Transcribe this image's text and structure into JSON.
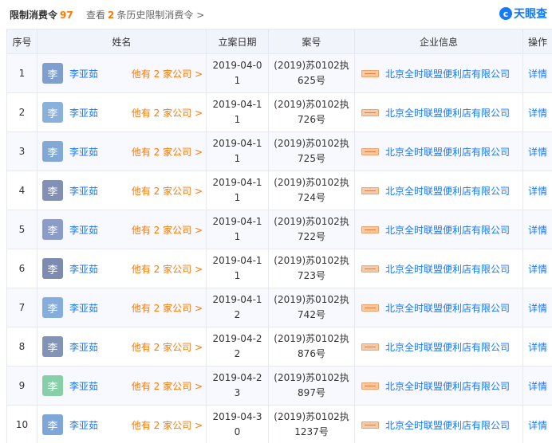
{
  "header": {
    "title": "限制消费令",
    "count": "97",
    "history_prefix": "查看",
    "history_count": "2",
    "history_suffix": "条历史限制消费令 >",
    "logo_mark": "c",
    "logo_text": "天眼查"
  },
  "columns": {
    "index": "序号",
    "name": "姓名",
    "date": "立案日期",
    "case": "案号",
    "company": "企业信息",
    "action": "操作"
  },
  "rows": [
    {
      "index": "1",
      "avatar": "李",
      "avatar_color": "#7f9fcf",
      "name": "李亚茹",
      "others": "他有 2 家公司 >",
      "date": "2019-04-01",
      "case": "(2019)苏0102执625号",
      "company": "北京全时联盟便利店有限公司",
      "action": "详情"
    },
    {
      "index": "2",
      "avatar": "李",
      "avatar_color": "#8ab0dc",
      "name": "李亚茹",
      "others": "他有 2 家公司 >",
      "date": "2019-04-11",
      "case": "(2019)苏0102执726号",
      "company": "北京全时联盟便利店有限公司",
      "action": "详情"
    },
    {
      "index": "3",
      "avatar": "李",
      "avatar_color": "#82a8d6",
      "name": "李亚茹",
      "others": "他有 2 家公司 >",
      "date": "2019-04-11",
      "case": "(2019)苏0102执725号",
      "company": "北京全时联盟便利店有限公司",
      "action": "详情"
    },
    {
      "index": "4",
      "avatar": "李",
      "avatar_color": "#8290b5",
      "name": "李亚茹",
      "others": "他有 2 家公司 >",
      "date": "2019-04-11",
      "case": "(2019)苏0102执724号",
      "company": "北京全时联盟便利店有限公司",
      "action": "详情"
    },
    {
      "index": "5",
      "avatar": "李",
      "avatar_color": "#8c9cc8",
      "name": "李亚茹",
      "others": "他有 2 家公司 >",
      "date": "2019-04-11",
      "case": "(2019)苏0102执722号",
      "company": "北京全时联盟便利店有限公司",
      "action": "详情"
    },
    {
      "index": "6",
      "avatar": "李",
      "avatar_color": "#7d8bb0",
      "name": "李亚茹",
      "others": "他有 2 家公司 >",
      "date": "2019-04-11",
      "case": "(2019)苏0102执723号",
      "company": "北京全时联盟便利店有限公司",
      "action": "详情"
    },
    {
      "index": "7",
      "avatar": "李",
      "avatar_color": "#86aedc",
      "name": "李亚茹",
      "others": "他有 2 家公司 >",
      "date": "2019-04-12",
      "case": "(2019)苏0102执742号",
      "company": "北京全时联盟便利店有限公司",
      "action": "详情"
    },
    {
      "index": "8",
      "avatar": "李",
      "avatar_color": "#8393b6",
      "name": "李亚茹",
      "others": "他有 2 家公司 >",
      "date": "2019-04-22",
      "case": "(2019)苏0102执876号",
      "company": "北京全时联盟便利店有限公司",
      "action": "详情"
    },
    {
      "index": "9",
      "avatar": "李",
      "avatar_color": "#86cfa8",
      "name": "李亚茹",
      "others": "他有 2 家公司 >",
      "date": "2019-04-23",
      "case": "(2019)苏0102执897号",
      "company": "北京全时联盟便利店有限公司",
      "action": "详情"
    },
    {
      "index": "10",
      "avatar": "李",
      "avatar_color": "#7ea6d6",
      "name": "李亚茹",
      "others": "他有 2 家公司 >",
      "date": "2019-04-30",
      "case": "(2019)苏0102执1237号",
      "company": "北京全时联盟便利店有限公司",
      "action": "详情"
    }
  ]
}
